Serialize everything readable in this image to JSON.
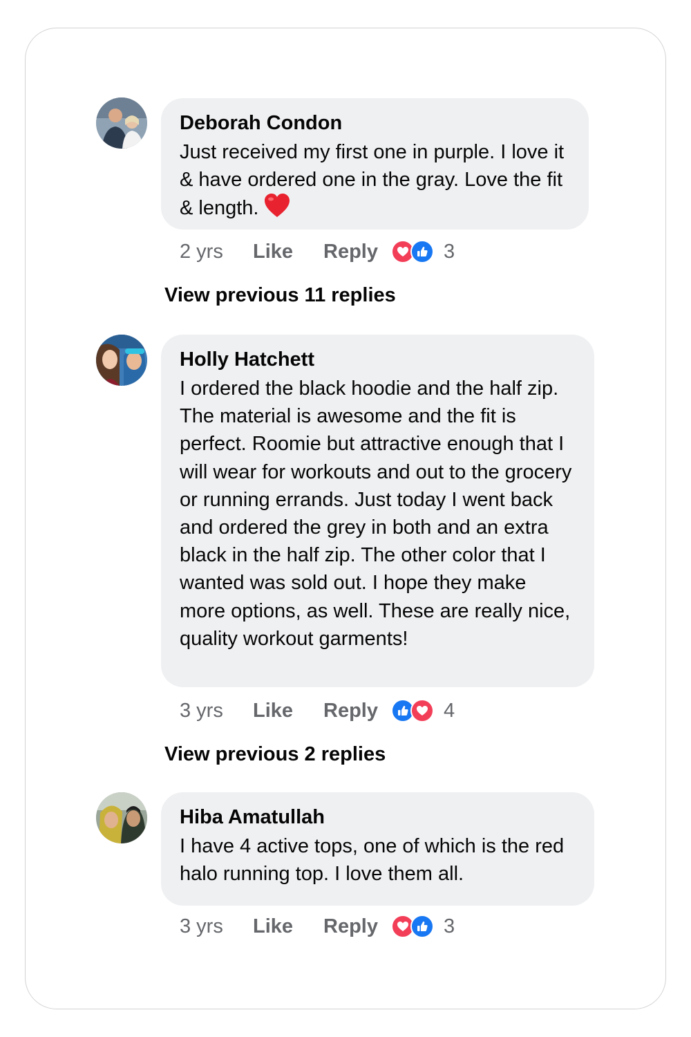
{
  "comments": [
    {
      "author": "Deborah Condon",
      "text": "Just received my first one in purple. I love it & have ordered one in the gray. Love the fit & length.",
      "emoji": "red-heart-emoji",
      "time": "2 yrs",
      "like_label": "Like",
      "reply_label": "Reply",
      "reactions": [
        "heart",
        "like"
      ],
      "reaction_count": "3"
    },
    {
      "author": "Holly Hatchett",
      "text": "I ordered the black hoodie and the half zip. The material is awesome and the fit is perfect. Roomie but attractive enough that I will wear for workouts and out to the grocery or running errands. Just today I went back and ordered the grey in both and an extra black in the half zip. The other color that I wanted was sold out. I hope they make more options, as well. These are really nice, quality workout garments!",
      "time": "3 yrs",
      "like_label": "Like",
      "reply_label": "Reply",
      "reactions": [
        "like",
        "heart"
      ],
      "reaction_count": "4"
    },
    {
      "author": "Hiba Amatullah",
      "text": "I have 4 active tops, one of which is the red halo running top. I love them all.",
      "time": "3 yrs",
      "like_label": "Like",
      "reply_label": "Reply",
      "reactions": [
        "heart",
        "like"
      ],
      "reaction_count": "3"
    }
  ],
  "view_previous": [
    "View previous 11 replies",
    "View previous 2 replies"
  ],
  "colors": {
    "bubble": "#eff0f2",
    "muted_text": "#65676b",
    "heart_reaction": "#f33e58",
    "like_reaction": "#1877f2"
  }
}
